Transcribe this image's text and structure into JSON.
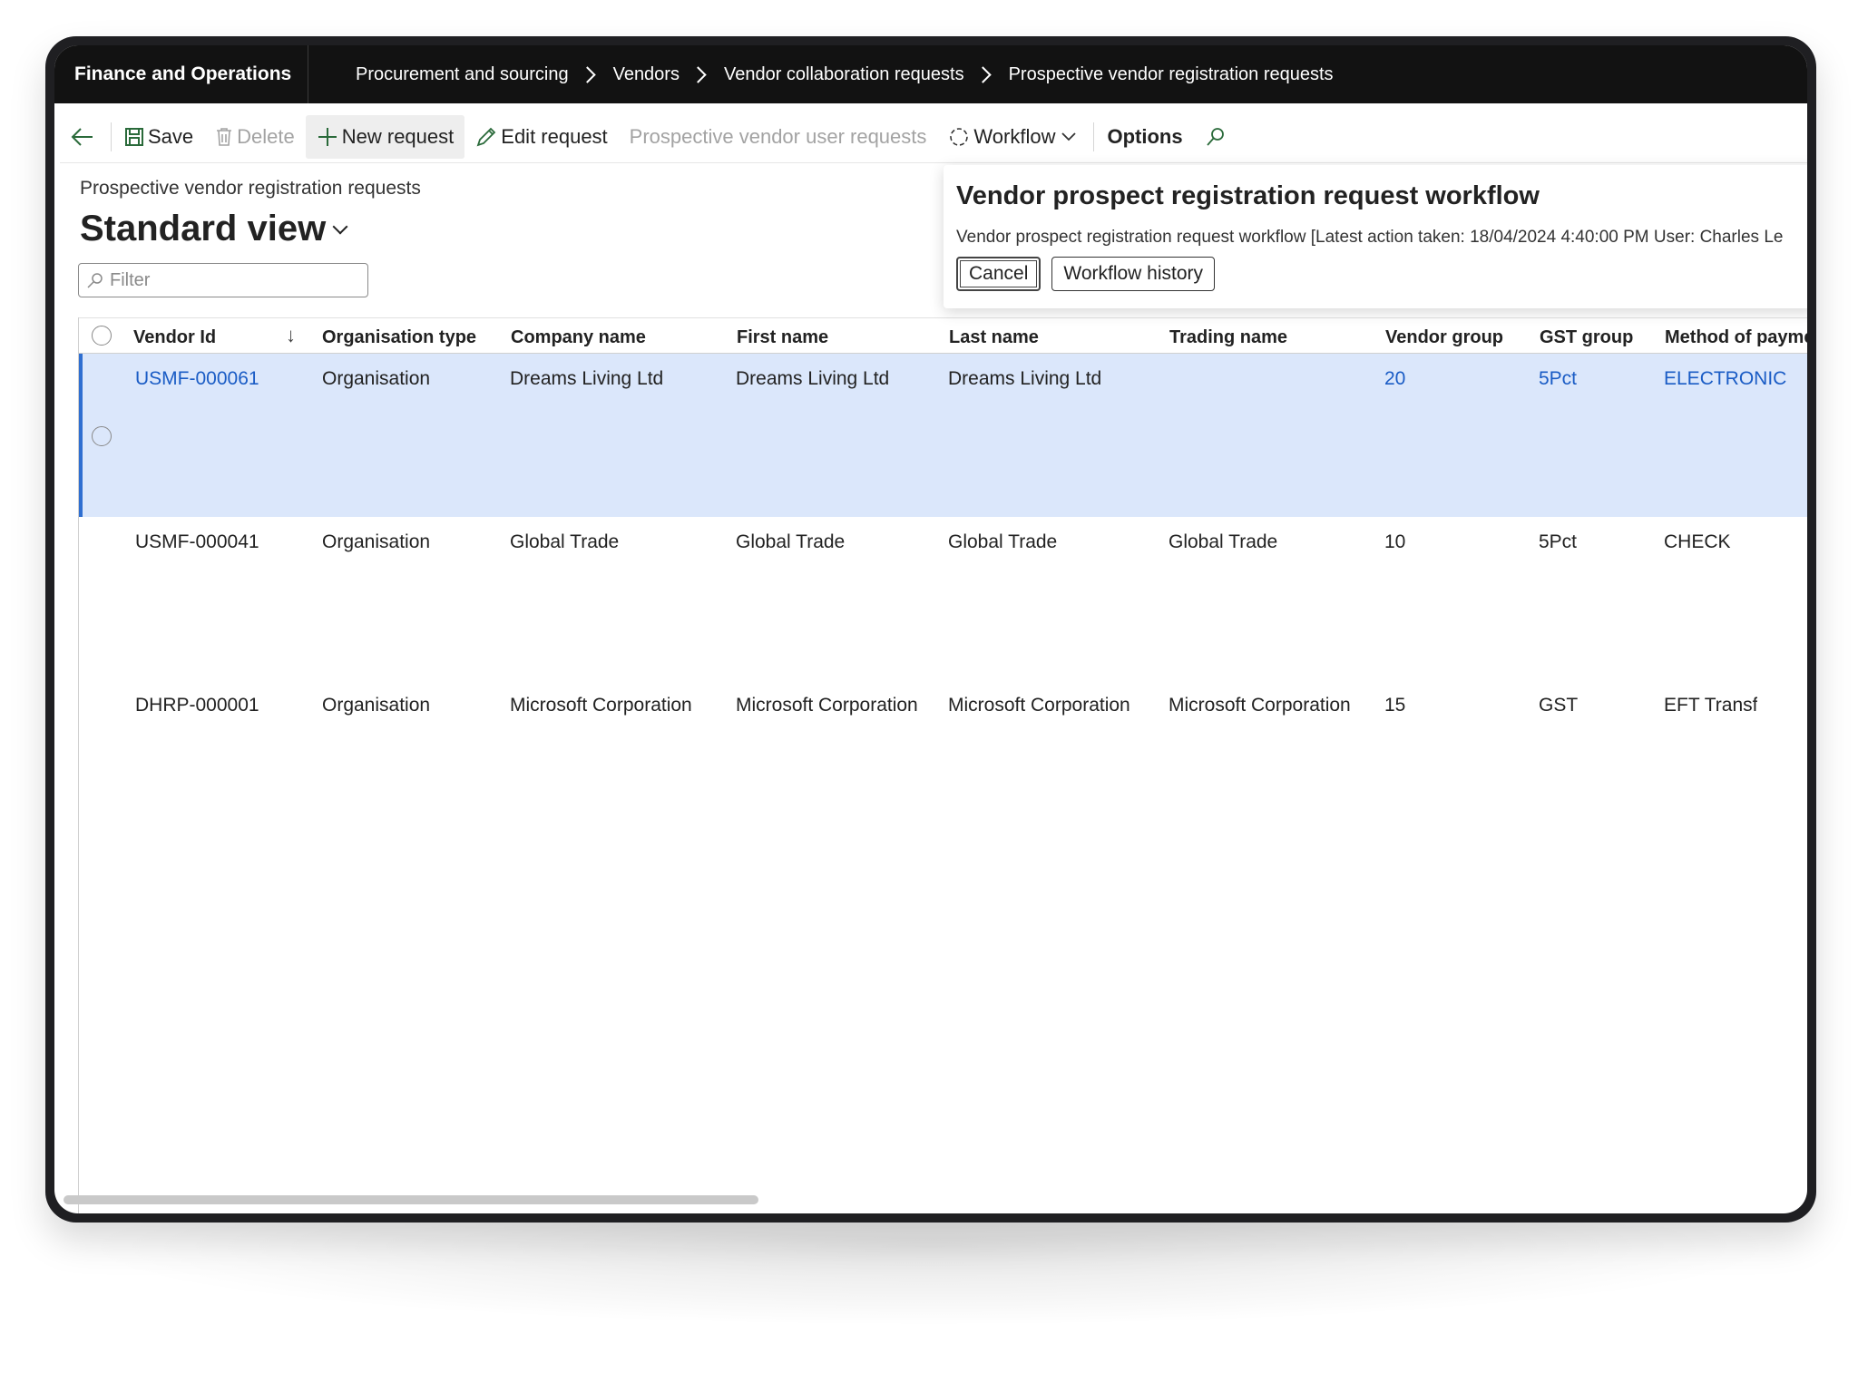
{
  "app": {
    "title": "Finance and Operations"
  },
  "breadcrumb": [
    "Procurement and sourcing",
    "Vendors",
    "Vendor collaboration requests",
    "Prospective vendor registration requests"
  ],
  "actions": {
    "save": "Save",
    "delete": "Delete",
    "new_request": "New request",
    "edit_request": "Edit request",
    "prospective_user_requests": "Prospective vendor user requests",
    "workflow": "Workflow",
    "options": "Options"
  },
  "page": {
    "subtitle": "Prospective vendor registration requests",
    "view": "Standard view",
    "filter_placeholder": "Filter"
  },
  "workflow_popup": {
    "title": "Vendor prospect registration request workflow",
    "description": "Vendor prospect registration request workflow [Latest action taken: 18/04/2024 4:40:00 PM User: Charles Le",
    "cancel": "Cancel",
    "history": "Workflow history"
  },
  "grid": {
    "columns": [
      "Vendor Id",
      "Organisation type",
      "Company name",
      "First name",
      "Last name",
      "Trading name",
      "Vendor group",
      "GST group",
      "Method of payme"
    ],
    "rows": [
      {
        "vendor_id": "USMF-000061",
        "org_type": "Organisation",
        "company": "Dreams Living Ltd",
        "first": "Dreams Living Ltd",
        "last": "Dreams Living Ltd",
        "trading": "",
        "group": "20",
        "gst": "5Pct",
        "payment": "ELECTRONIC",
        "selected": true
      },
      {
        "vendor_id": "USMF-000041",
        "org_type": "Organisation",
        "company": "Global Trade",
        "first": "Global Trade",
        "last": "Global Trade",
        "trading": "Global Trade",
        "group": "10",
        "gst": "5Pct",
        "payment": "CHECK",
        "selected": false
      },
      {
        "vendor_id": "DHRP-000001",
        "org_type": "Organisation",
        "company": "Microsoft Corporation",
        "first": "Microsoft Corporation",
        "last": "Microsoft Corporation",
        "trading": "Microsoft Corporation",
        "group": "15",
        "gst": "GST",
        "payment": "EFT Transf",
        "selected": false
      }
    ]
  },
  "colors": {
    "accent": "#2f6fd1",
    "selected_row": "#dbe7fb",
    "link": "#1a5cc5",
    "topbar": "#121212"
  },
  "icons": [
    "back-arrow-icon",
    "save-icon",
    "delete-icon",
    "plus-icon",
    "pencil-icon",
    "workflow-icon",
    "chevron-down-icon",
    "search-icon",
    "filter-search-icon",
    "sort-down-icon"
  ]
}
